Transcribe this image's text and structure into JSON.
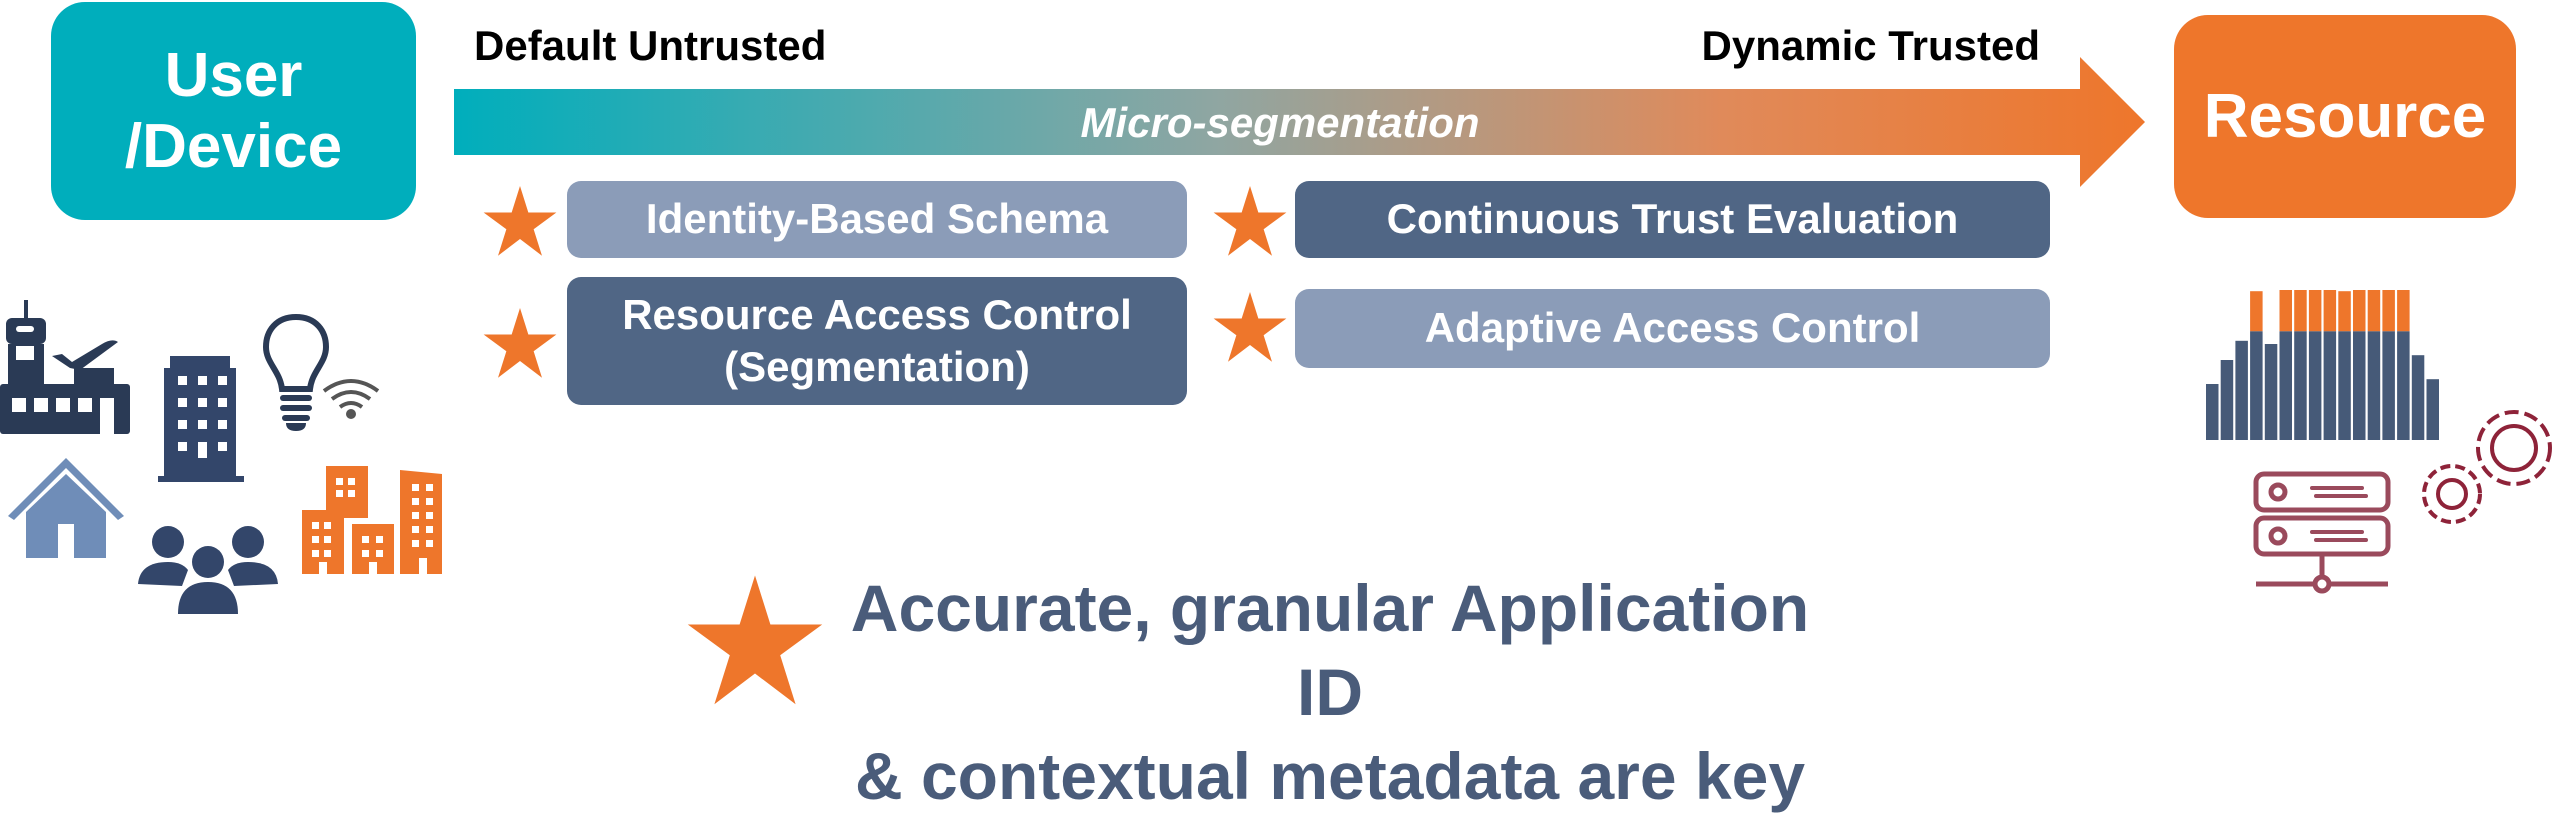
{
  "source": {
    "label": "User\n/Device",
    "line1": "User",
    "line2": "/Device",
    "color": "#00aebc"
  },
  "target": {
    "label": "Resource",
    "color": "#ee762b"
  },
  "arrow": {
    "left_label": "Default Untrusted",
    "right_label": "Dynamic Trusted",
    "center_label": "Micro-segmentation",
    "gradient_start": "#00aebc",
    "gradient_end": "#ee762b"
  },
  "capabilities": [
    {
      "label": "Identity-Based Schema",
      "style": "light",
      "starred": true
    },
    {
      "label": "Continuous Trust Evaluation",
      "style": "dark",
      "starred": true
    },
    {
      "label": "Resource Access Control",
      "label2": "(Segmentation)",
      "style": "dark",
      "starred": true
    },
    {
      "label": "Adaptive Access Control",
      "style": "light",
      "starred": true
    }
  ],
  "key_message": {
    "line1": "Accurate, granular Application ID",
    "line2": "& contextual metadata are key"
  },
  "user_icons": [
    "airport-icon",
    "office-building-icon",
    "smart-bulb-icon",
    "wifi-icon",
    "home-icon",
    "people-group-icon",
    "city-buildings-icon"
  ],
  "resource_icons": [
    "stacked-bar-chart-icon",
    "server-icon",
    "gears-icon"
  ],
  "colors": {
    "dark_box": "#506685",
    "light_box": "#8b9cb8",
    "star": "#ee762b",
    "text_dark": "#4a5c7a"
  }
}
